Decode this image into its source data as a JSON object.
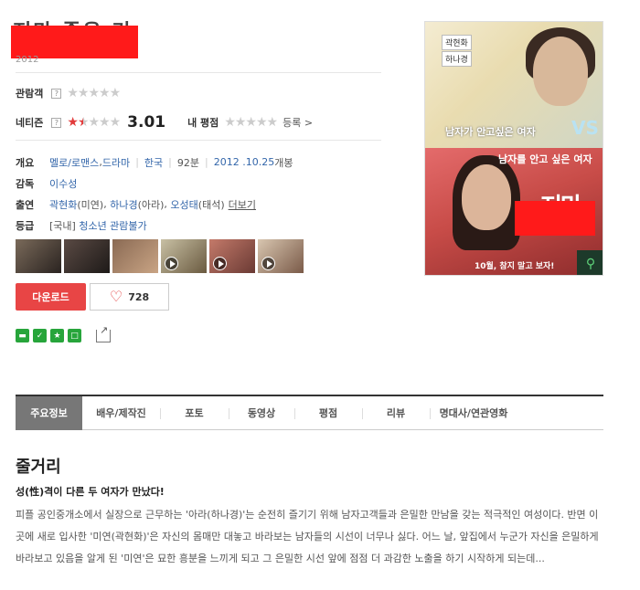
{
  "movie": {
    "title_visible_fragment": "저만 좋은 기",
    "year": "2012"
  },
  "ratings": {
    "audience_label": "관람객",
    "audience_help": "?",
    "netizen_label": "네티즌",
    "netizen_help": "?",
    "netizen_score": "3.01",
    "netizen_star_fraction": 0.3,
    "my_rating_label": "내 평점",
    "register_label": "등록 >",
    "star_color": "#e23b3b"
  },
  "info": {
    "overview_label": "개요",
    "genres": [
      "멜로/로맨스",
      "드라마"
    ],
    "genre_sep": ", ",
    "country": "한국",
    "runtime": "92분",
    "release_date": "2012 .10.25",
    "release_suffix": "개봉",
    "director_label": "감독",
    "director": "이수성",
    "cast_label": "출연",
    "cast": [
      {
        "name": "곽현화",
        "role": "(미연)"
      },
      {
        "name": "하나경",
        "role": "(아라)"
      },
      {
        "name": "오성태",
        "role": "(태석)"
      }
    ],
    "cast_more": "더보기",
    "grade_label": "등급",
    "grade_prefix": "[국내]",
    "grade": "청소년 관람불가"
  },
  "thumbnails": [
    {
      "icon": "photo",
      "colors": [
        "#7a6a5a",
        "#2a2320"
      ]
    },
    {
      "icon": "photo",
      "colors": [
        "#5a4a44",
        "#1e1a18"
      ]
    },
    {
      "icon": "photo",
      "colors": [
        "#8a6a54",
        "#c9a484"
      ]
    },
    {
      "icon": "play-icon",
      "colors": [
        "#c8c0a4",
        "#6a5a40"
      ]
    },
    {
      "icon": "play-icon",
      "colors": [
        "#c47a6a",
        "#6a3a34"
      ]
    },
    {
      "icon": "play-icon",
      "colors": [
        "#d8c6b0",
        "#7a5a48"
      ]
    }
  ],
  "actions": {
    "download_label": "다운로드",
    "like_count": "728",
    "download_color": "#e84545"
  },
  "vod_icons": [
    "naver-vod-icon",
    "check-icon",
    "star-icon",
    "square-icon",
    "share-icon"
  ],
  "tabs": [
    "주요정보",
    "배우/제작진",
    "포토",
    "동영상",
    "평점",
    "리뷰",
    "명대사/연관영화"
  ],
  "active_tab": 0,
  "synopsis": {
    "heading": "줄거리",
    "tagline": "성(性)격이 다른 두 여자가 만났다!",
    "body": "피플 공인중개소에서 실장으로 근무하는 '아라(하나경)'는 순전히 즐기기 위해 남자고객들과 은밀한 만남을 갖는 적극적인 여성이다. 반면 이곳에 새로 입사한 '미연(곽현화)'은 자신의 몸매만 대놓고 바라보는 남자들의 시선이 너무나 싫다. 어느 날, 앞집에서 누군가 자신을 은밀하게 바라보고 있음을 알게 된 '미연'은 묘한 흥분을 느끼게 되고 그 은밀한 시선 앞에 점점 더 과감한 노출을 하기 시작하게 되는데..."
  },
  "poster": {
    "name_tag_1": "곽현화",
    "name_tag_2": "하나경",
    "subtitle_top": "남자가 안고싶은 여자",
    "vs": "VS",
    "subtitle_bottom": "남자를 안고 싶은 여자",
    "big_title_fragment": "저만",
    "date_line": "10월, 참지 말고 보자!"
  }
}
